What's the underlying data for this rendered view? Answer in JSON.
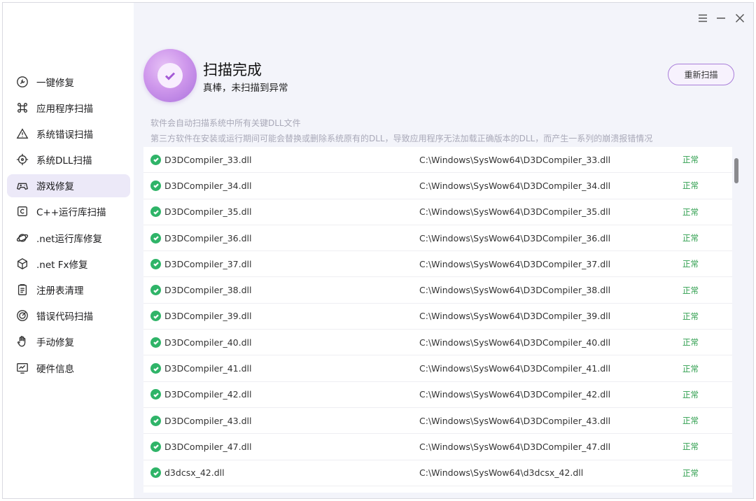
{
  "sidebar": {
    "items": [
      {
        "label": "一键修复",
        "icon": "wrench-circle-icon"
      },
      {
        "label": "应用程序扫描",
        "icon": "command-icon"
      },
      {
        "label": "系统错误扫描",
        "icon": "warning-icon"
      },
      {
        "label": "系统DLL扫描",
        "icon": "target-icon"
      },
      {
        "label": "游戏修复",
        "icon": "gamepad-icon",
        "active": true
      },
      {
        "label": "C++运行库扫描",
        "icon": "c-box-icon"
      },
      {
        "label": ".net运行库修复",
        "icon": "planet-icon"
      },
      {
        "label": ".net Fx修复",
        "icon": "cube-icon"
      },
      {
        "label": "注册表清理",
        "icon": "clipboard-icon"
      },
      {
        "label": "错误代码扫描",
        "icon": "radar-icon"
      },
      {
        "label": "手动修复",
        "icon": "hand-icon"
      },
      {
        "label": "硬件信息",
        "icon": "monitor-chart-icon"
      }
    ]
  },
  "header": {
    "title": "扫描完成",
    "subtitle": "真棒，未扫描到异常",
    "rescan_label": "重新扫描",
    "accent": "#a971dc"
  },
  "description": {
    "line1": "软件会自动扫描系统中所有关键DLL文件",
    "line2": "第三方软件在安装或运行期间可能会替换或删除系统原有的DLL，导致应用程序无法加载正确版本的DLL，而产生一系列的崩溃报错情况"
  },
  "rows": [
    {
      "name": "D3DCompiler_33.dll",
      "path": "C:\\Windows\\SysWow64\\D3DCompiler_33.dll",
      "status": "正常"
    },
    {
      "name": "D3DCompiler_34.dll",
      "path": "C:\\Windows\\SysWow64\\D3DCompiler_34.dll",
      "status": "正常"
    },
    {
      "name": "D3DCompiler_35.dll",
      "path": "C:\\Windows\\SysWow64\\D3DCompiler_35.dll",
      "status": "正常"
    },
    {
      "name": "D3DCompiler_36.dll",
      "path": "C:\\Windows\\SysWow64\\D3DCompiler_36.dll",
      "status": "正常"
    },
    {
      "name": "D3DCompiler_37.dll",
      "path": "C:\\Windows\\SysWow64\\D3DCompiler_37.dll",
      "status": "正常"
    },
    {
      "name": "D3DCompiler_38.dll",
      "path": "C:\\Windows\\SysWow64\\D3DCompiler_38.dll",
      "status": "正常"
    },
    {
      "name": "D3DCompiler_39.dll",
      "path": "C:\\Windows\\SysWow64\\D3DCompiler_39.dll",
      "status": "正常"
    },
    {
      "name": "D3DCompiler_40.dll",
      "path": "C:\\Windows\\SysWow64\\D3DCompiler_40.dll",
      "status": "正常"
    },
    {
      "name": "D3DCompiler_41.dll",
      "path": "C:\\Windows\\SysWow64\\D3DCompiler_41.dll",
      "status": "正常"
    },
    {
      "name": "D3DCompiler_42.dll",
      "path": "C:\\Windows\\SysWow64\\D3DCompiler_42.dll",
      "status": "正常"
    },
    {
      "name": "D3DCompiler_43.dll",
      "path": "C:\\Windows\\SysWow64\\D3DCompiler_43.dll",
      "status": "正常"
    },
    {
      "name": "D3DCompiler_47.dll",
      "path": "C:\\Windows\\SysWow64\\D3DCompiler_47.dll",
      "status": "正常"
    },
    {
      "name": "d3dcsx_42.dll",
      "path": "C:\\Windows\\SysWow64\\d3dcsx_42.dll",
      "status": "正常"
    }
  ],
  "colors": {
    "status_ok": "#2e9e4d",
    "check_green": "#2fb468",
    "active_bg": "#ece9f8"
  }
}
